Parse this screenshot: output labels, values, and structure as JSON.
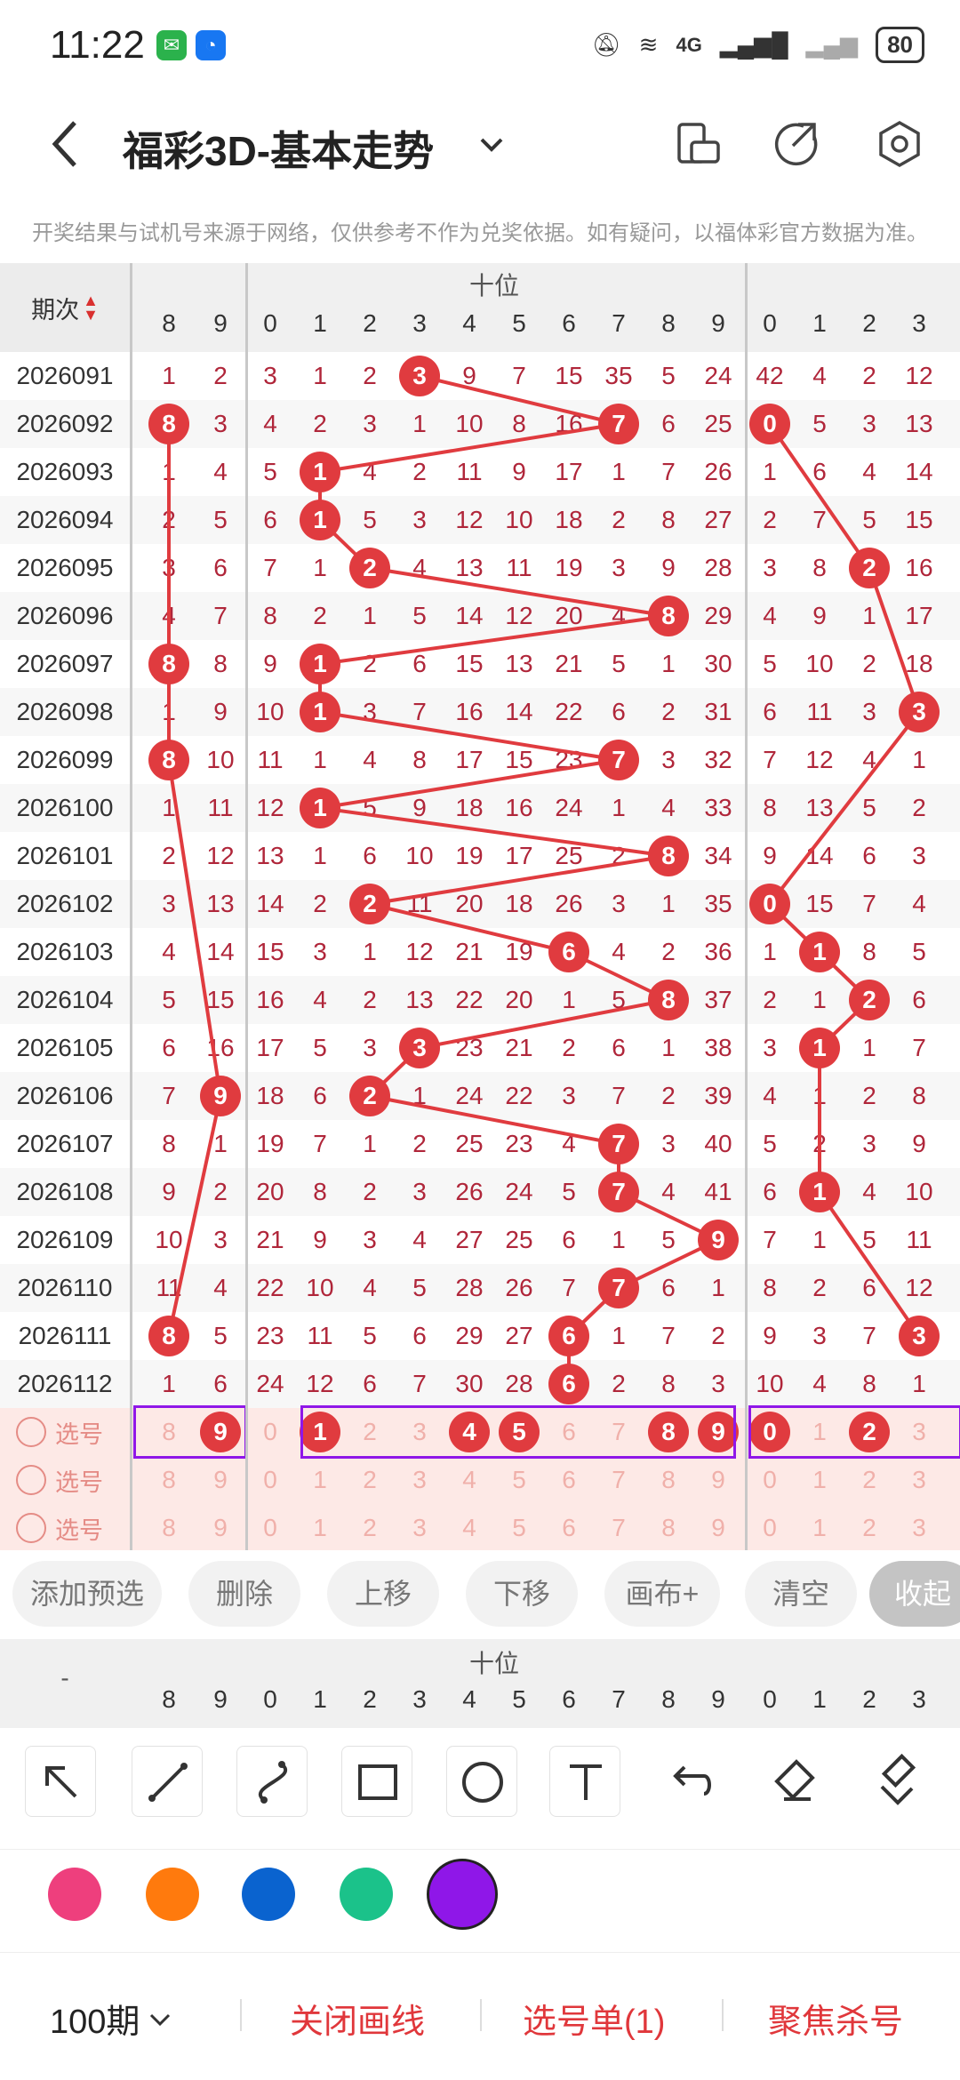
{
  "status": {
    "time": "11:22",
    "network": "4G",
    "battery": "80"
  },
  "header": {
    "title": "福彩3D-基本走势"
  },
  "notice": "开奖结果与试机号来源于网络，仅供参考不作为兑奖依据。如有疑问，以福体彩官方数据为准。",
  "table": {
    "period_header": "期次",
    "section_label": "十位",
    "col_headers": [
      "8",
      "9",
      "0",
      "1",
      "2",
      "3",
      "4",
      "5",
      "6",
      "7",
      "8",
      "9",
      "0",
      "1",
      "2",
      "3"
    ],
    "rows": [
      {
        "period": "2026091",
        "cells": [
          "1",
          "2",
          "3",
          "1",
          "2",
          "3",
          "9",
          "7",
          "15",
          "35",
          "5",
          "24",
          "42",
          "4",
          "2",
          "12"
        ]
      },
      {
        "period": "2026092",
        "cells": [
          "8",
          "3",
          "4",
          "2",
          "3",
          "1",
          "10",
          "8",
          "16",
          "7",
          "6",
          "25",
          "0",
          "5",
          "3",
          "13"
        ]
      },
      {
        "period": "2026093",
        "cells": [
          "1",
          "4",
          "5",
          "1",
          "4",
          "2",
          "11",
          "9",
          "17",
          "1",
          "7",
          "26",
          "1",
          "6",
          "4",
          "14"
        ]
      },
      {
        "period": "2026094",
        "cells": [
          "2",
          "5",
          "6",
          "1",
          "5",
          "3",
          "12",
          "10",
          "18",
          "2",
          "8",
          "27",
          "2",
          "7",
          "5",
          "15"
        ]
      },
      {
        "period": "2026095",
        "cells": [
          "3",
          "6",
          "7",
          "1",
          "2",
          "4",
          "13",
          "11",
          "19",
          "3",
          "9",
          "28",
          "3",
          "8",
          "2",
          "16"
        ]
      },
      {
        "period": "2026096",
        "cells": [
          "4",
          "7",
          "8",
          "2",
          "1",
          "5",
          "14",
          "12",
          "20",
          "4",
          "8",
          "29",
          "4",
          "9",
          "1",
          "17"
        ]
      },
      {
        "period": "2026097",
        "cells": [
          "8",
          "8",
          "9",
          "1",
          "2",
          "6",
          "15",
          "13",
          "21",
          "5",
          "1",
          "30",
          "5",
          "10",
          "2",
          "18"
        ]
      },
      {
        "period": "2026098",
        "cells": [
          "1",
          "9",
          "10",
          "1",
          "3",
          "7",
          "16",
          "14",
          "22",
          "6",
          "2",
          "31",
          "6",
          "11",
          "3",
          "3"
        ]
      },
      {
        "period": "2026099",
        "cells": [
          "8",
          "10",
          "11",
          "1",
          "4",
          "8",
          "17",
          "15",
          "23",
          "7",
          "3",
          "32",
          "7",
          "12",
          "4",
          "1"
        ]
      },
      {
        "period": "2026100",
        "cells": [
          "1",
          "11",
          "12",
          "1",
          "5",
          "9",
          "18",
          "16",
          "24",
          "1",
          "4",
          "33",
          "8",
          "13",
          "5",
          "2"
        ]
      },
      {
        "period": "2026101",
        "cells": [
          "2",
          "12",
          "13",
          "1",
          "6",
          "10",
          "19",
          "17",
          "25",
          "2",
          "8",
          "34",
          "9",
          "14",
          "6",
          "3"
        ]
      },
      {
        "period": "2026102",
        "cells": [
          "3",
          "13",
          "14",
          "2",
          "2",
          "11",
          "20",
          "18",
          "26",
          "3",
          "1",
          "35",
          "0",
          "15",
          "7",
          "4"
        ]
      },
      {
        "period": "2026103",
        "cells": [
          "4",
          "14",
          "15",
          "3",
          "1",
          "12",
          "21",
          "19",
          "6",
          "4",
          "2",
          "36",
          "1",
          "1",
          "8",
          "5"
        ]
      },
      {
        "period": "2026104",
        "cells": [
          "5",
          "15",
          "16",
          "4",
          "2",
          "13",
          "22",
          "20",
          "1",
          "5",
          "8",
          "37",
          "2",
          "1",
          "2",
          "6"
        ]
      },
      {
        "period": "2026105",
        "cells": [
          "6",
          "16",
          "17",
          "5",
          "3",
          "3",
          "23",
          "21",
          "2",
          "6",
          "1",
          "38",
          "3",
          "1",
          "1",
          "7"
        ]
      },
      {
        "period": "2026106",
        "cells": [
          "7",
          "9",
          "18",
          "6",
          "2",
          "1",
          "24",
          "22",
          "3",
          "7",
          "2",
          "39",
          "4",
          "1",
          "2",
          "8"
        ]
      },
      {
        "period": "2026107",
        "cells": [
          "8",
          "1",
          "19",
          "7",
          "1",
          "2",
          "25",
          "23",
          "4",
          "7",
          "3",
          "40",
          "5",
          "2",
          "3",
          "9"
        ]
      },
      {
        "period": "2026108",
        "cells": [
          "9",
          "2",
          "20",
          "8",
          "2",
          "3",
          "26",
          "24",
          "5",
          "7",
          "4",
          "41",
          "6",
          "1",
          "4",
          "10"
        ]
      },
      {
        "period": "2026109",
        "cells": [
          "10",
          "3",
          "21",
          "9",
          "3",
          "4",
          "27",
          "25",
          "6",
          "1",
          "5",
          "9",
          "7",
          "1",
          "5",
          "11"
        ]
      },
      {
        "period": "2026110",
        "cells": [
          "11",
          "4",
          "22",
          "10",
          "4",
          "5",
          "28",
          "26",
          "7",
          "7",
          "6",
          "1",
          "8",
          "2",
          "6",
          "12"
        ]
      },
      {
        "period": "2026111",
        "cells": [
          "8",
          "5",
          "23",
          "11",
          "5",
          "6",
          "29",
          "27",
          "6",
          "1",
          "7",
          "2",
          "9",
          "3",
          "7",
          "3"
        ]
      },
      {
        "period": "2026112",
        "cells": [
          "1",
          "6",
          "24",
          "12",
          "6",
          "7",
          "30",
          "28",
          "6",
          "2",
          "8",
          "3",
          "10",
          "4",
          "8",
          "1"
        ]
      }
    ],
    "balls": [
      [
        0,
        5
      ],
      [
        1,
        0
      ],
      [
        1,
        9
      ],
      [
        1,
        12
      ],
      [
        2,
        3
      ],
      [
        3,
        3
      ],
      [
        4,
        4
      ],
      [
        4,
        14
      ],
      [
        5,
        10
      ],
      [
        6,
        0
      ],
      [
        6,
        3
      ],
      [
        7,
        3
      ],
      [
        7,
        15
      ],
      [
        8,
        0
      ],
      [
        8,
        9
      ],
      [
        9,
        3
      ],
      [
        10,
        10
      ],
      [
        11,
        4
      ],
      [
        11,
        12
      ],
      [
        12,
        8
      ],
      [
        12,
        13
      ],
      [
        13,
        10
      ],
      [
        13,
        14
      ],
      [
        14,
        5
      ],
      [
        14,
        13
      ],
      [
        15,
        1
      ],
      [
        15,
        4
      ],
      [
        16,
        9
      ],
      [
        17,
        9
      ],
      [
        17,
        13
      ],
      [
        18,
        11
      ],
      [
        19,
        9
      ],
      [
        20,
        0
      ],
      [
        20,
        8
      ],
      [
        20,
        15
      ],
      [
        21,
        8
      ]
    ],
    "select_label": "选号",
    "select_digits": [
      "8",
      "9",
      "0",
      "1",
      "2",
      "3",
      "4",
      "5",
      "6",
      "7",
      "8",
      "9",
      "0",
      "1",
      "2",
      "3"
    ],
    "selected": [
      1,
      3,
      6,
      7,
      10,
      11,
      12,
      14
    ]
  },
  "buttons": [
    "添加预选",
    "删除",
    "上移",
    "下移",
    "画布+",
    "清空",
    "收起"
  ],
  "footer_table": {
    "placeholder": "-",
    "section_label": "十位",
    "col_headers": [
      "8",
      "9",
      "0",
      "1",
      "2",
      "3",
      "4",
      "5",
      "6",
      "7",
      "8",
      "9",
      "0",
      "1",
      "2",
      "3"
    ]
  },
  "tools": [
    "select-arrow-icon",
    "line-icon",
    "curve-icon",
    "rectangle-icon",
    "circle-icon",
    "text-icon",
    "undo-icon",
    "eraser-icon",
    "clear-all-icon"
  ],
  "colors": [
    "#ee3f7d",
    "#ff7a0d",
    "#0a63cf",
    "#1bc28a",
    "#8f17e8"
  ],
  "footer": {
    "period_select": "100期",
    "close_lines": "关闭画线",
    "ticket": "选号单(1)",
    "focus": "聚焦杀号"
  }
}
